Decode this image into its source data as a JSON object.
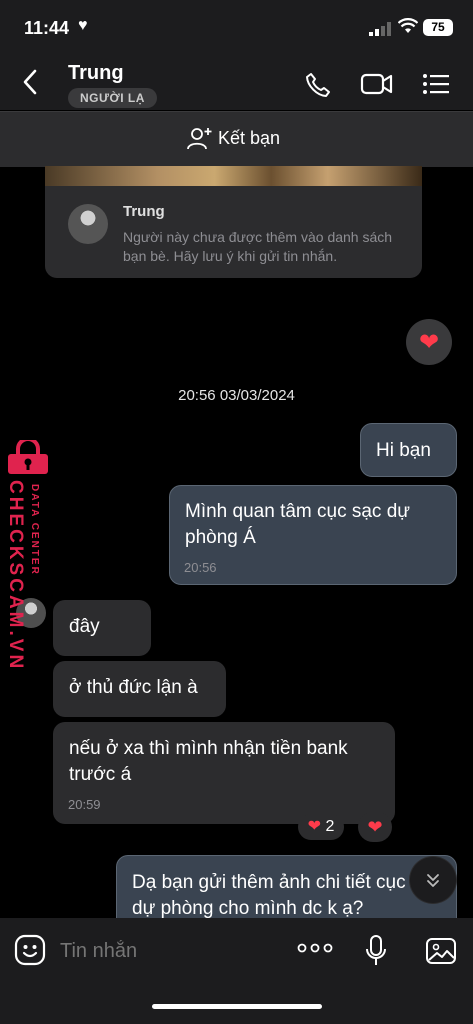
{
  "status_bar": {
    "time": "11:44",
    "battery": "75"
  },
  "header": {
    "name": "Trung",
    "tag": "NGƯỜI LẠ"
  },
  "friend_bar": {
    "label": "Kết bạn"
  },
  "profile_card": {
    "name": "Trung",
    "notice": "Người này chưa được thêm vào danh sách bạn bè. Hãy lưu ý khi gửi tin nhắn."
  },
  "date_separator": "20:56 03/03/2024",
  "messages": [
    {
      "text": "Hi bạn"
    },
    {
      "text": "Mình quan tâm cục sạc dự phòng Á",
      "time": "20:56"
    },
    {
      "text": "đây"
    },
    {
      "text": "ở thủ đức lận à"
    },
    {
      "text": "nếu ở xa thì mình nhận tiền bank trước á",
      "time": "20:59"
    },
    {
      "text": "Dạ bạn gửi thêm ảnh chi tiết cục sạc dự phòng cho mình dc k ạ?"
    }
  ],
  "reactions": {
    "count": "2"
  },
  "watermark": {
    "brand": "CHECKSCAM.VN",
    "sub": "DATA CENTER"
  },
  "composer": {
    "placeholder": "Tin nhắn"
  },
  "colors": {
    "accent_heart": "#ff3b4b",
    "outgoing_bubble": "#3a4451",
    "incoming_bubble": "#2c2c2e",
    "watermark": "#e0234e"
  }
}
